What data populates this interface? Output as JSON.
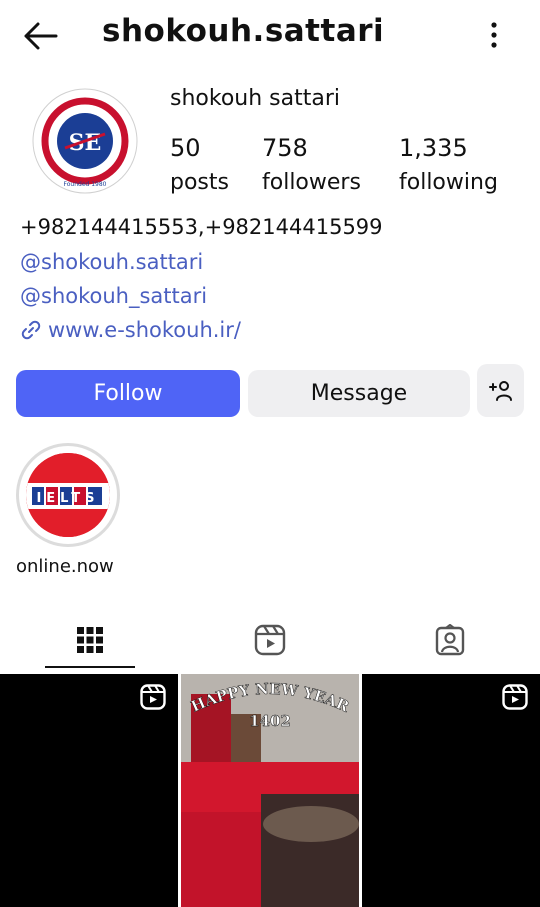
{
  "header": {
    "username": "shokouh.sattari",
    "back_icon": "arrow-left-icon",
    "menu_icon": "more-vertical-icon"
  },
  "profile": {
    "display_name": "shokouh  sattari",
    "avatar_text_top": "GOOD TO BE HELPFUL",
    "avatar_text_bottom": "SHOKOUH-E-IRAN",
    "avatar_founded": "Founded 1980",
    "stats": {
      "posts_count": "50",
      "posts_label": "posts",
      "followers_count": "758",
      "followers_label": "followers",
      "following_count": "1,335",
      "following_label": "following"
    },
    "bio": {
      "phones": "+982144415553,+982144415599",
      "handle_1": "@shokouh.sattari",
      "handle_2": "@shokouh_sattari",
      "website": "www.e-shokouh.ir/"
    }
  },
  "actions": {
    "follow_label": "Follow",
    "message_label": "Message",
    "add_user_icon": "add-user-icon"
  },
  "highlights": [
    {
      "label": "online.now",
      "image_text": "IELTS"
    }
  ],
  "tabs": [
    "grid-icon",
    "reels-icon",
    "tagged-icon"
  ],
  "grid": {
    "post_2_caption_line1": "HAPPY NEW YEAR",
    "post_2_caption_line2": "1402"
  },
  "colors": {
    "accent": "#4f64f6",
    "link": "#4a5fc1",
    "secondary_button": "#efeff1",
    "tile_red": "#c8102e"
  }
}
